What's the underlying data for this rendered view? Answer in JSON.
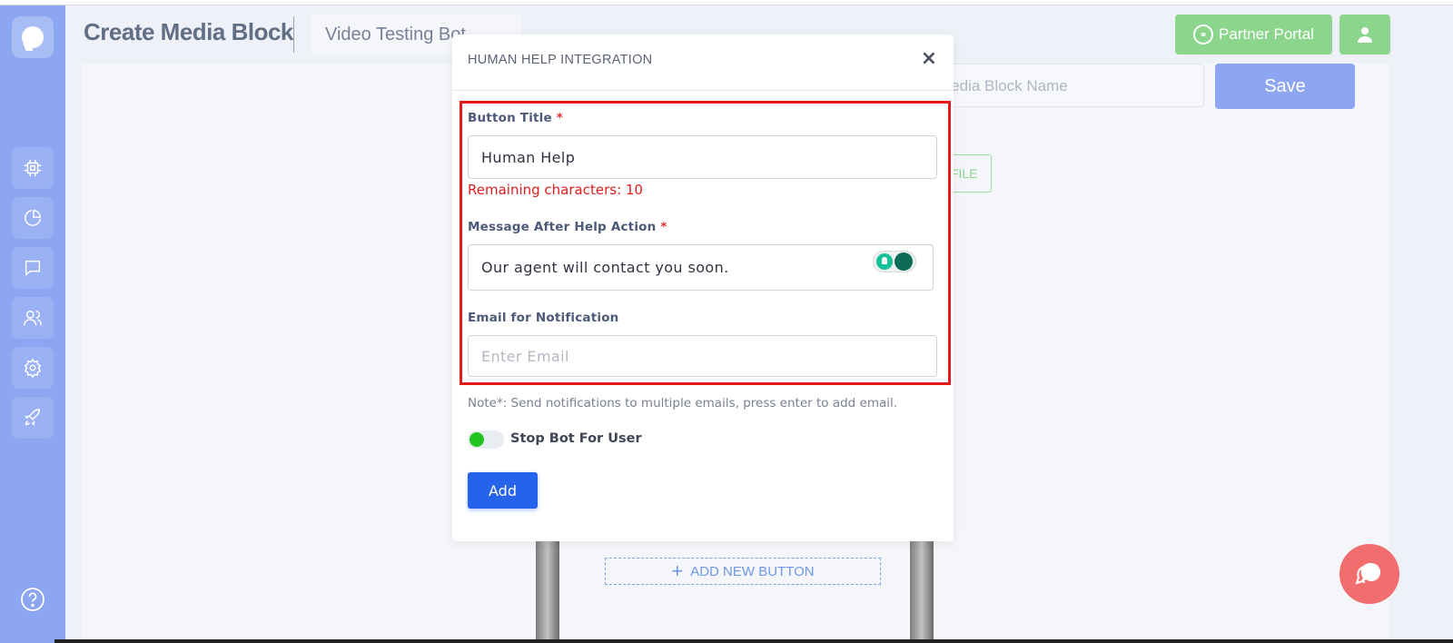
{
  "header": {
    "page_title": "Create Media Block",
    "bot_select_value": "Video Testing Bot",
    "partner_portal_label": "Partner Portal"
  },
  "sidebar": {
    "items": [
      {
        "icon": "cpu-icon"
      },
      {
        "icon": "pie-chart-icon"
      },
      {
        "icon": "message-icon"
      },
      {
        "icon": "users-icon"
      },
      {
        "icon": "settings-icon"
      },
      {
        "icon": "rocket-icon"
      }
    ],
    "help_icon": "help-circle-icon"
  },
  "background": {
    "media_block_name_placeholder": "Media Block Name",
    "save_label": "Save",
    "file_button_label": "FILE",
    "add_new_button_label": "ADD NEW BUTTON"
  },
  "modal": {
    "title": "HUMAN HELP INTEGRATION",
    "close_symbol": "×",
    "button_title_label": "Button Title",
    "button_title_value": "Human Help",
    "remaining_text": "Remaining characters: 10",
    "message_label": "Message After Help Action",
    "message_value": "Our agent will contact you soon.",
    "email_label": "Email for Notification",
    "email_placeholder": "Enter Email",
    "required_mark": "*",
    "note": "Note*: Send notifications to multiple emails, press enter to add email.",
    "stop_bot_label": "Stop Bot For User",
    "stop_bot_enabled": true,
    "add_label": "Add"
  },
  "colors": {
    "sidebar": "#8da6f1",
    "partner_green": "#8bd58d",
    "primary_blue": "#2563eb",
    "error_red": "#e21c1c",
    "chat_fab": "#f26d6d"
  }
}
